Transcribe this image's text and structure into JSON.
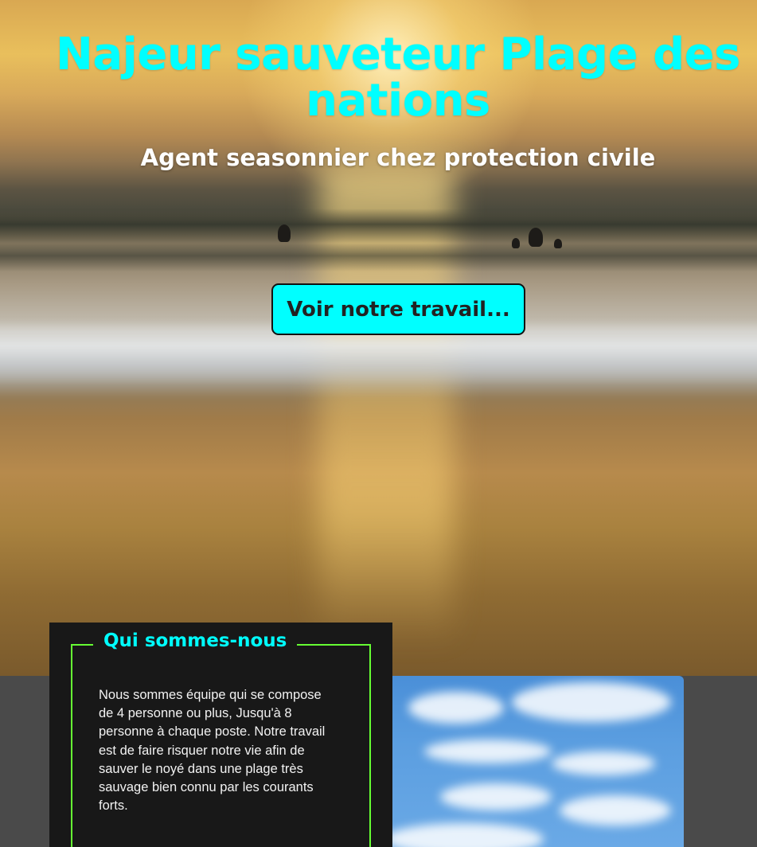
{
  "hero": {
    "title": "Najeur sauveteur Plage des nations",
    "subtitle": "Agent seasonnier chez protection civile",
    "cta_label": "Voir notre travail..."
  },
  "about": {
    "title": "Qui sommes-nous",
    "text": "Nous sommes équipe qui se compose de 4 personne ou plus, Jusqu'à 8 personne à chaque poste. Notre travail est de faire risquer notre vie afin de sauver le noyé dans une plage très sauvage bien connu par les courants forts."
  },
  "colors": {
    "accent": "#00ffff",
    "frame": "#66ff33",
    "card_bg": "#181818",
    "section_bg": "#4a4a4a"
  }
}
